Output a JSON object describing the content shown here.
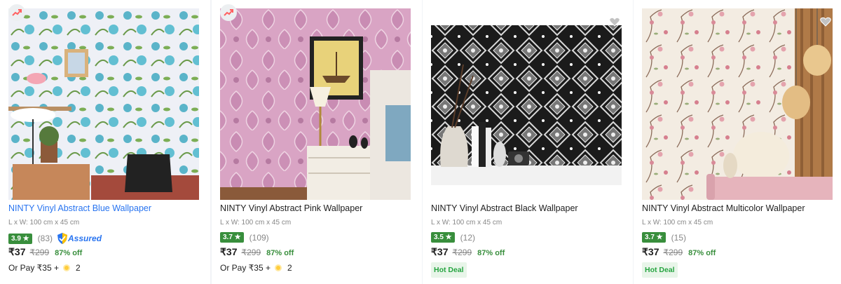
{
  "products": [
    {
      "title": "NINTY Vinyl Abstract Blue Wallpaper",
      "size": "L x W: 100 cm x 45 cm",
      "rating": "3.9",
      "reviews": "(83)",
      "assured_label": "Assured",
      "price": "₹37",
      "mrp": "₹299",
      "discount": "87% off",
      "pay_text": "Or Pay ₹35 +",
      "coins": "2",
      "image_icon": "trending-icon"
    },
    {
      "title": "NINTY Vinyl Abstract Pink Wallpaper",
      "size": "L x W: 100 cm x 45 cm",
      "rating": "3.7",
      "reviews": "(109)",
      "price": "₹37",
      "mrp": "₹299",
      "discount": "87% off",
      "pay_text": "Or Pay ₹35 +",
      "coins": "2",
      "image_icon": "trending-icon"
    },
    {
      "title": "NINTY Vinyl Abstract Black Wallpaper",
      "size": "L x W: 100 cm x 45 cm",
      "rating": "3.5",
      "reviews": "(12)",
      "price": "₹37",
      "mrp": "₹299",
      "discount": "87% off",
      "badge": "Hot Deal",
      "image_icon": "heart-icon"
    },
    {
      "title": "NINTY Vinyl Abstract Multicolor Wallpaper",
      "size": "L x W: 100 cm x 45 cm",
      "rating": "3.7",
      "reviews": "(15)",
      "price": "₹37",
      "mrp": "₹299",
      "discount": "87% off",
      "badge": "Hot Deal",
      "image_icon": "heart-icon"
    }
  ],
  "colors": {
    "rating_green": "#388e3c",
    "link_blue": "#2874f0",
    "discount_green": "#388e3c",
    "hot_deal_bg": "#e8f5e9"
  }
}
